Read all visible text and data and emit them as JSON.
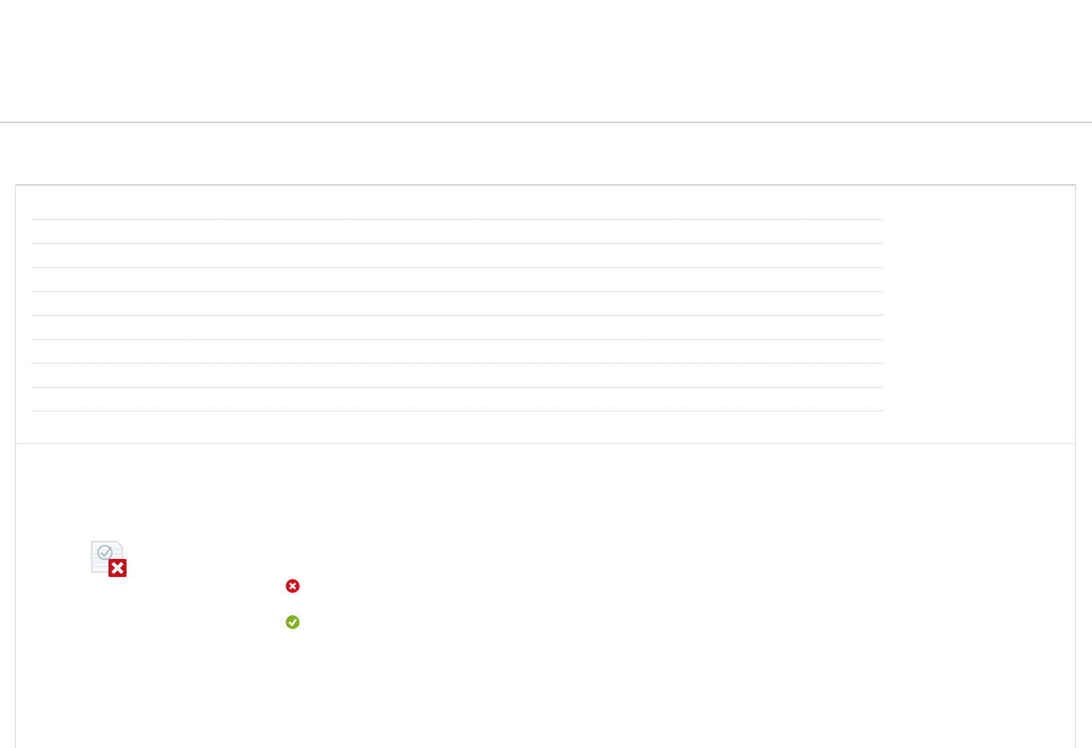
{
  "document_status": {
    "kind": "error"
  },
  "checks": [
    {
      "kind": "error"
    },
    {
      "kind": "success"
    }
  ]
}
